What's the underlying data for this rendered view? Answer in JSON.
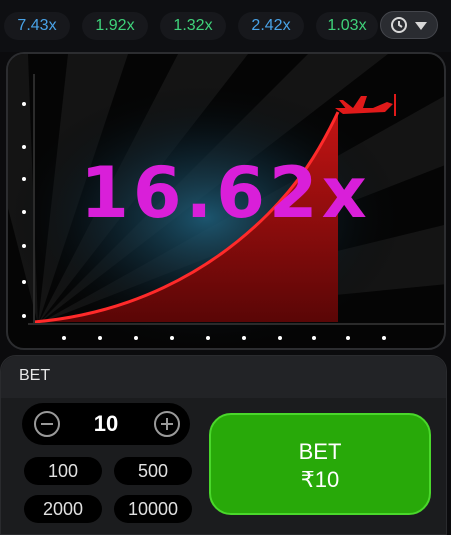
{
  "history": [
    {
      "value": "7.43x",
      "color": "#49a3e8"
    },
    {
      "value": "1.92x",
      "color": "#3fd27a"
    },
    {
      "value": "1.32x",
      "color": "#3fd27a"
    },
    {
      "value": "2.42x",
      "color": "#49a3e8"
    },
    {
      "value": "1.03x",
      "color": "#3fd27a"
    }
  ],
  "history_button": {
    "icon": "clock-icon",
    "arrow": "caret-down-icon"
  },
  "game": {
    "multiplier": "16.62x",
    "multiplier_color": "#d91fd9",
    "curve_color": "#ff2a2a",
    "plane_color": "#e11a1a",
    "plane_icon": "airplane-icon"
  },
  "bet_panel": {
    "title": "BET",
    "stake": "10",
    "quick_amounts": [
      "100",
      "500",
      "2000",
      "10000"
    ],
    "bet_button_label": "BET",
    "bet_button_amount": "₹10",
    "accent": "#28a909"
  }
}
